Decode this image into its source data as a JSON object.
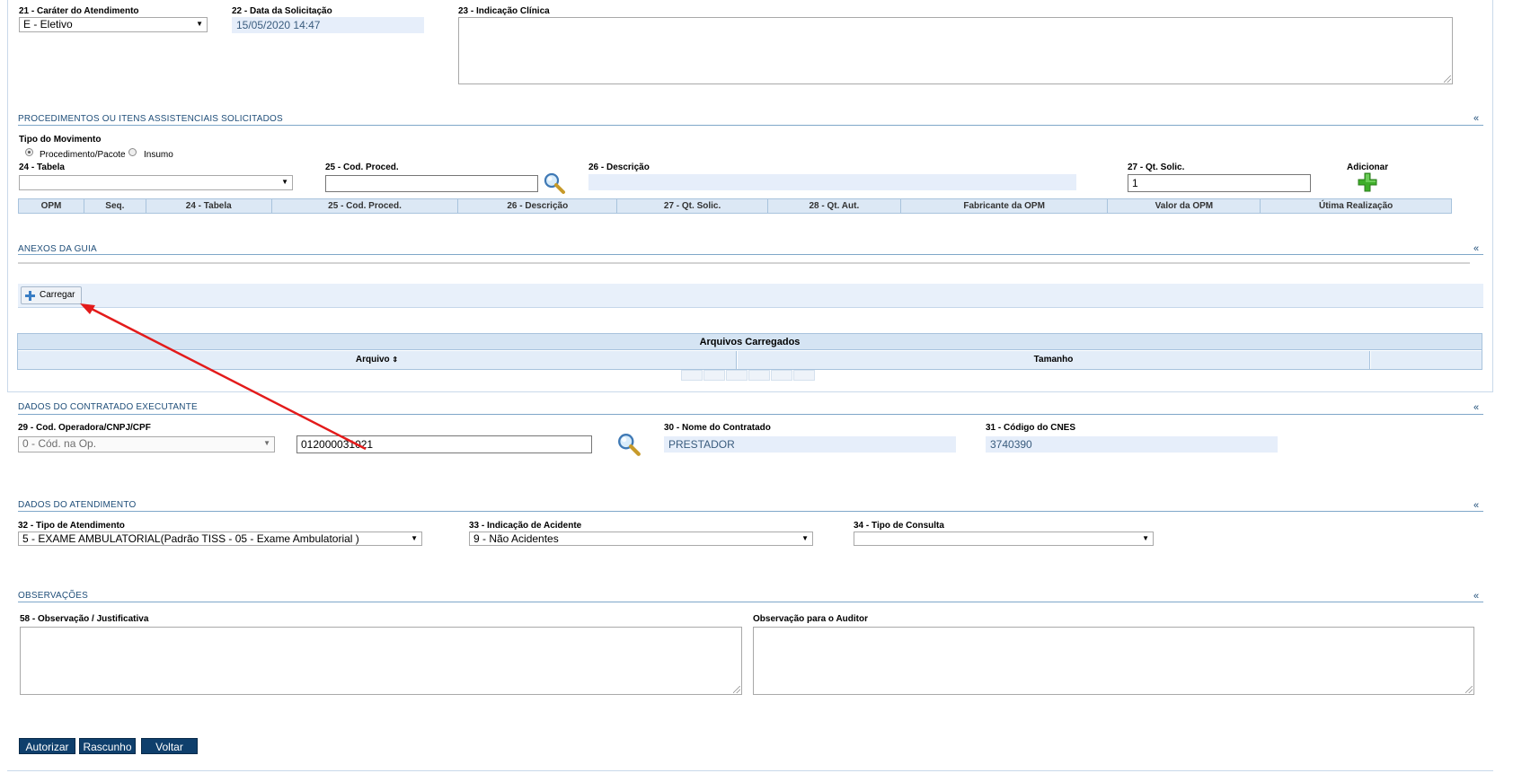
{
  "fields_top": {
    "carater_label": "21 - Caráter do Atendimento",
    "carater_value": "E - Eletivo",
    "data_label": "22 - Data da Solicitação",
    "data_value": "15/05/2020 14:47",
    "indicacao_label": "23 - Indicação Clínica",
    "indicacao_value": ""
  },
  "procedimentos": {
    "title": "PROCEDIMENTOS OU ITENS ASSISTENCIAIS SOLICITADOS",
    "collapse": "«",
    "tipo_movimento_label": "Tipo do Movimento",
    "radio_procedimento": "Procedimento/Pacote",
    "radio_insumo": "Insumo",
    "tabela_label": "24 - Tabela",
    "tabela_value": "",
    "cod_proced_label": "25 - Cod. Proced.",
    "cod_proced_value": "",
    "descricao_label": "26 - Descrição",
    "descricao_value": "",
    "qt_solic_label": "27 - Qt. Solic.",
    "qt_solic_value": "1",
    "adicionar_label": "Adicionar",
    "columns": [
      "OPM",
      "Seq.",
      "24 - Tabela",
      "25 - Cod. Proced.",
      "26 - Descrição",
      "27 - Qt. Solic.",
      "28 - Qt. Aut.",
      "Fabricante da OPM",
      "Valor da OPM",
      "Útima Realização"
    ]
  },
  "anexos": {
    "title": "ANEXOS DA GUIA",
    "collapse": "«",
    "carregar_label": "Carregar",
    "table_title": "Arquivos Carregados",
    "col_arquivo": "Arquivo",
    "col_sort_icon": "⇕",
    "col_tamanho": "Tamanho"
  },
  "contratado": {
    "title": "DADOS DO CONTRATADO EXECUTANTE",
    "collapse": "«",
    "cod_operadora_label": "29 - Cod. Operadora/CNPJ/CPF",
    "cod_operadora_select": "0 - Cód. na Op.",
    "cod_operadora_value": "012000031021",
    "nome_label": "30 - Nome do Contratado",
    "nome_value": "PRESTADOR",
    "cnes_label": "31 - Código do CNES",
    "cnes_value": "3740390"
  },
  "atendimento": {
    "title": "DADOS DO ATENDIMENTO",
    "collapse": "«",
    "tipo_atendimento_label": "32 - Tipo de Atendimento",
    "tipo_atendimento_value": "5 - EXAME AMBULATORIAL(Padrão TISS - 05 - Exame Ambulatorial )",
    "indicacao_acidente_label": "33 - Indicação de Acidente",
    "indicacao_acidente_value": "9 - Não Acidentes",
    "tipo_consulta_label": "34 - Tipo de Consulta",
    "tipo_consulta_value": ""
  },
  "observacoes": {
    "title": "OBSERVAÇÕES",
    "collapse": "«",
    "justificativa_label": "58 - Observação / Justificativa",
    "auditor_label": "Observação para o Auditor"
  },
  "buttons": {
    "autorizar": "Autorizar",
    "rascunho": "Rascunho",
    "voltar": "Voltar"
  },
  "icons": {
    "search": "search-magnifier-icon",
    "add": "green-plus-icon",
    "carregar": "blue-plus-icon",
    "annotation": "red-arrow-annotation"
  },
  "colors": {
    "section_title": "#1f4e79",
    "readonly_bg": "#e6eefa",
    "button_bg": "#0f3f6c",
    "grid_header_bg": "#dce8f5",
    "annotation_red": "#e31b1b",
    "add_green": "#3fae2a"
  }
}
